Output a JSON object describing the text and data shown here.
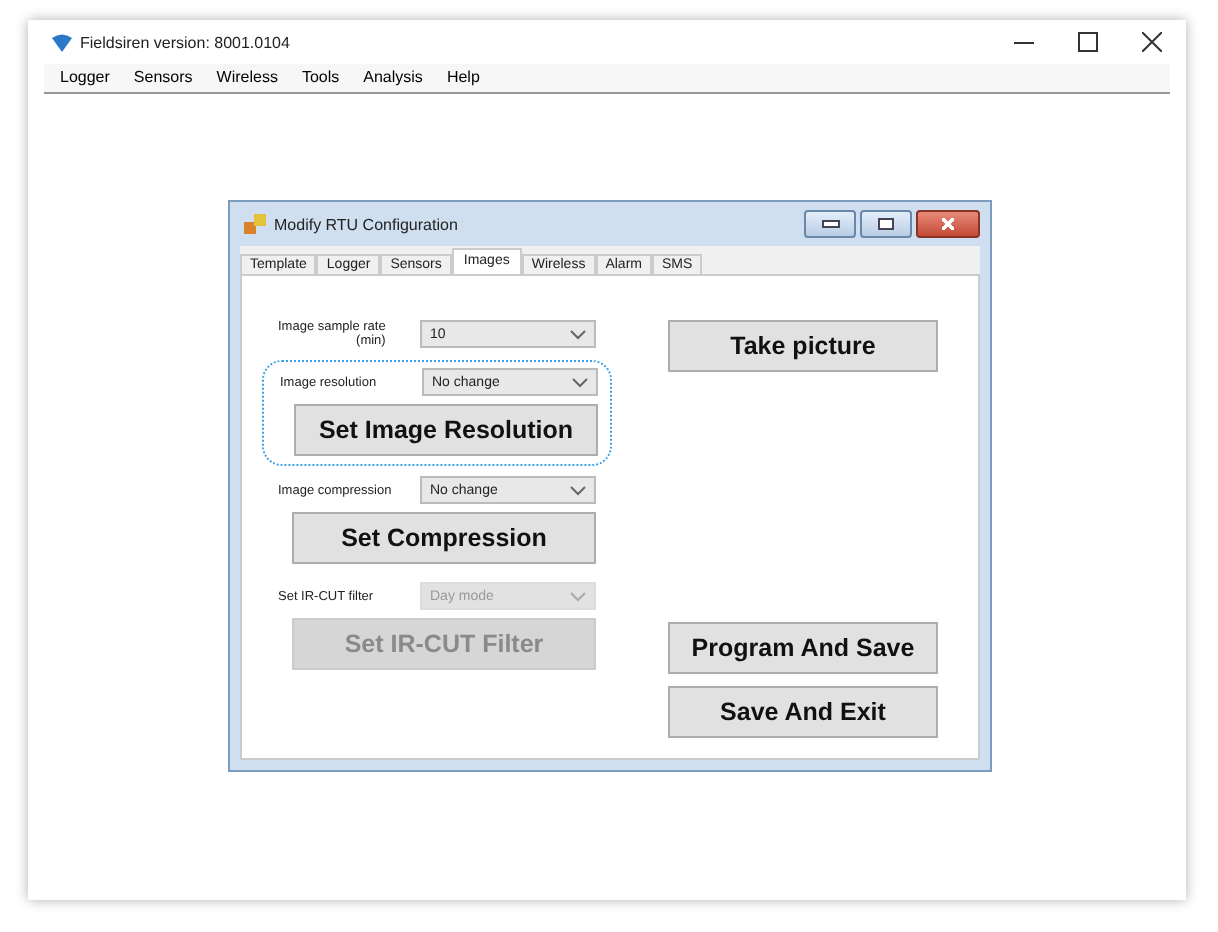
{
  "window": {
    "title": "Fieldsiren version: 8001.0104"
  },
  "menu": [
    "Logger",
    "Sensors",
    "Wireless",
    "Tools",
    "Analysis",
    "Help"
  ],
  "dialog": {
    "title": "Modify RTU Configuration",
    "tabs": [
      {
        "label": "Template",
        "selected": false
      },
      {
        "label": "Logger",
        "selected": false
      },
      {
        "label": "Sensors",
        "selected": false
      },
      {
        "label": "Images",
        "selected": true
      },
      {
        "label": "Wireless",
        "selected": false
      },
      {
        "label": "Alarm",
        "selected": false
      },
      {
        "label": "SMS",
        "selected": false
      }
    ],
    "settings": [
      {
        "label": "Image sample rate\n(min)",
        "value": "10",
        "disabled": false,
        "highlighted": false
      },
      {
        "label": "Image resolution",
        "value": "No change",
        "disabled": false,
        "highlighted": true,
        "button": "Set Image Resolution"
      },
      {
        "label": "Image compression",
        "value": "No change",
        "disabled": false,
        "highlighted": false,
        "button": "Set Compression"
      },
      {
        "label": "Set IR-CUT filter",
        "value": "Day mode",
        "disabled": true,
        "highlighted": false,
        "button": "Set IR-CUT Filter"
      }
    ],
    "top_buttons": [
      "Take picture"
    ],
    "bottom_buttons": [
      "Program And Save",
      "Save And Exit"
    ]
  }
}
